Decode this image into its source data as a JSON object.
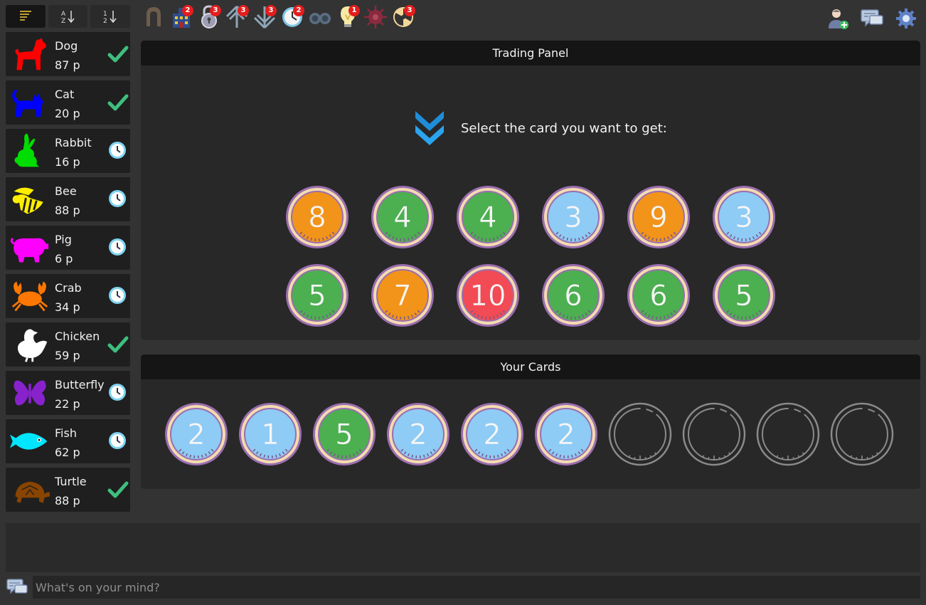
{
  "players": [
    {
      "name": "Dog",
      "score": "87 p",
      "color": "#ff0000",
      "icon": "dog-icon",
      "status": "done"
    },
    {
      "name": "Cat",
      "score": "20 p",
      "color": "#0000ff",
      "icon": "cat-icon",
      "status": "done"
    },
    {
      "name": "Rabbit",
      "score": "16 p",
      "color": "#00dd00",
      "icon": "rabbit-icon",
      "status": "waiting"
    },
    {
      "name": "Bee",
      "score": "88 p",
      "color": "#ffee00",
      "icon": "bee-icon",
      "status": "waiting"
    },
    {
      "name": "Pig",
      "score": "6 p",
      "color": "#ff00ff",
      "icon": "pig-icon",
      "status": "waiting"
    },
    {
      "name": "Crab",
      "score": "34 p",
      "color": "#ff7700",
      "icon": "crab-icon",
      "status": "waiting"
    },
    {
      "name": "Chicken",
      "score": "59 p",
      "color": "#ffffff",
      "icon": "chicken-icon",
      "status": "done"
    },
    {
      "name": "Butterfly",
      "score": "22 p",
      "color": "#8822cc",
      "icon": "butterfly-icon",
      "status": "waiting"
    },
    {
      "name": "Fish",
      "score": "62 p",
      "color": "#00e6ff",
      "icon": "fish-icon",
      "status": "waiting"
    },
    {
      "name": "Turtle",
      "score": "88 p",
      "color": "#884400",
      "icon": "turtle-icon",
      "status": "done"
    }
  ],
  "toolbar": [
    {
      "icon": "horseshoe-icon",
      "badge": ""
    },
    {
      "icon": "building-icon",
      "badge": "2"
    },
    {
      "icon": "lock-icon",
      "badge": "3"
    },
    {
      "icon": "arrow-up-icon",
      "badge": "3"
    },
    {
      "icon": "arrow-down-icon",
      "badge": "3"
    },
    {
      "icon": "clock-icon",
      "badge": "2"
    },
    {
      "icon": "binoculars-icon",
      "badge": ""
    },
    {
      "icon": "lightbulb-icon",
      "badge": "1"
    },
    {
      "icon": "virus-icon",
      "badge": ""
    },
    {
      "icon": "radiation-icon",
      "badge": "3"
    }
  ],
  "trading": {
    "title": "Trading Panel",
    "prompt": "Select the card you want to get:",
    "cards": [
      {
        "value": "8",
        "color": "orange"
      },
      {
        "value": "4",
        "color": "green"
      },
      {
        "value": "4",
        "color": "green"
      },
      {
        "value": "3",
        "color": "blue"
      },
      {
        "value": "9",
        "color": "orange"
      },
      {
        "value": "3",
        "color": "blue"
      },
      {
        "value": "5",
        "color": "green"
      },
      {
        "value": "7",
        "color": "orange"
      },
      {
        "value": "10",
        "color": "red"
      },
      {
        "value": "6",
        "color": "green"
      },
      {
        "value": "6",
        "color": "green"
      },
      {
        "value": "5",
        "color": "green"
      }
    ]
  },
  "your_cards": {
    "title": "Your Cards",
    "cards": [
      {
        "value": "2",
        "color": "blue"
      },
      {
        "value": "1",
        "color": "blue"
      },
      {
        "value": "5",
        "color": "green"
      },
      {
        "value": "2",
        "color": "blue"
      },
      {
        "value": "2",
        "color": "blue"
      },
      {
        "value": "2",
        "color": "blue"
      },
      {
        "value": "",
        "color": "empty"
      },
      {
        "value": "",
        "color": "empty"
      },
      {
        "value": "",
        "color": "empty"
      },
      {
        "value": "",
        "color": "empty"
      }
    ]
  },
  "chat": {
    "placeholder": "What's on your mind?"
  },
  "colors": {
    "orange": "#f2941a",
    "green": "#4caf50",
    "blue": "#8ecbf5",
    "red": "#f24b55",
    "check": "#3fbf7f",
    "clock": "#7fd4f0"
  }
}
